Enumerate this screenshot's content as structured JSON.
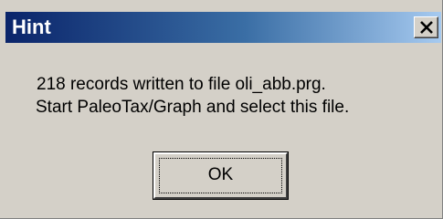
{
  "dialog": {
    "title": "Hint",
    "message_lines": [
      "218 records written to file oli_abb.prg.",
      "Start PaleoTax/Graph and select this file."
    ],
    "ok_label": "OK",
    "close_icon": "close-x-icon"
  },
  "colors": {
    "titlebar_start": "#0a246a",
    "titlebar_end": "#a6caf0",
    "face": "#d4d0c8"
  }
}
